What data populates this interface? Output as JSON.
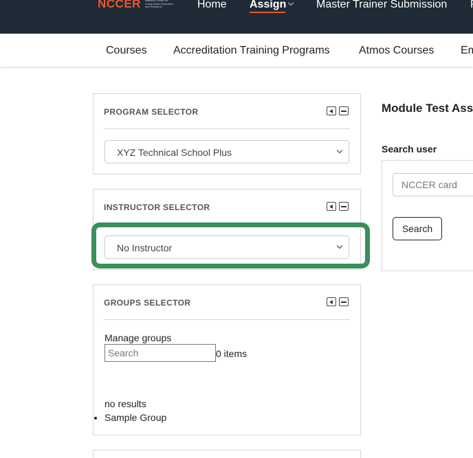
{
  "header": {
    "logo": {
      "mark": "NCCER",
      "tagline": "National Center for Construction Education and Research"
    },
    "nav": [
      {
        "label": "Home",
        "active": false
      },
      {
        "label": "Assign",
        "active": true
      },
      {
        "label": "Master Trainer Submission",
        "active": false
      },
      {
        "label": "R",
        "active": false
      }
    ]
  },
  "subnav": {
    "items": [
      "Courses",
      "Accreditation Training Programs",
      "Atmos Courses",
      "Em"
    ]
  },
  "panels": {
    "program": {
      "title": "PROGRAM SELECTOR",
      "selected": "XYZ Technical School Plus"
    },
    "instructor": {
      "title": "INSTRUCTOR SELECTOR",
      "selected": "No Instructor"
    },
    "groups": {
      "title": "GROUPS SELECTOR",
      "manage_label": "Manage groups",
      "search_placeholder": "Search",
      "count": "0 items",
      "empty_text": "no results",
      "items": [
        "Sample Group"
      ]
    }
  },
  "main": {
    "title": "Module Test Ass",
    "search_user_label": "Search user",
    "card_placeholder": "NCCER card",
    "search_button": "Search"
  },
  "colors": {
    "topbar": "#1e2a36",
    "accent": "#e8582a",
    "highlight": "#3a8f5c"
  }
}
